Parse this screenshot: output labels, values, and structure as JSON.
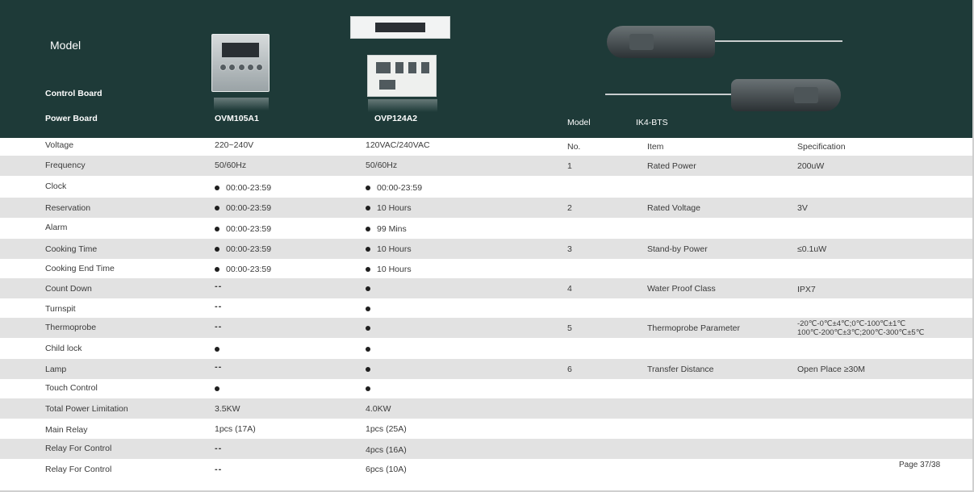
{
  "header": {
    "model_label": "Model",
    "control_board_label": "Control Board",
    "power_board_label": "Power Board",
    "model_a": "OVM105A1",
    "model_b": "OVP124A2",
    "probe_model_label": "Model",
    "probe_model_value": "IK4-BTS"
  },
  "board_table": {
    "rows": [
      {
        "label": "Voltage",
        "a": "220~240V",
        "b": "120VAC/240VAC"
      },
      {
        "label": "Frequency",
        "a": "50/60Hz",
        "b": "50/60Hz"
      },
      {
        "label": "Clock",
        "a": "00:00-23:59",
        "b": "00:00-23:59"
      },
      {
        "label": "Reservation",
        "a": "00:00-23:59",
        "b": "10 Hours"
      },
      {
        "label": "Alarm",
        "a": "00:00-23:59",
        "b": "99 Mins"
      },
      {
        "label": "Cooking Time",
        "a": "00:00-23:59",
        "b": "10 Hours"
      },
      {
        "label": "Cooking End Time",
        "a": "00:00-23:59",
        "b": "10 Hours"
      },
      {
        "label": "Count Down",
        "a": "--",
        "b": ""
      },
      {
        "label": "Turnspit",
        "a": "--",
        "b": ""
      },
      {
        "label": "Thermoprobe",
        "a": "--",
        "b": ""
      },
      {
        "label": "Child lock",
        "a": "",
        "b": ""
      },
      {
        "label": "Lamp",
        "a": "--",
        "b": ""
      },
      {
        "label": "Touch Control",
        "a": "",
        "b": ""
      },
      {
        "label": "Total Power Limitation",
        "a": "3.5KW",
        "b": "4.0KW"
      },
      {
        "label": "Main Relay",
        "a": "1pcs  (17A)",
        "b": "1pcs  (25A)"
      },
      {
        "label": "Relay For Control",
        "a": "--",
        "b": "4pcs  (16A)"
      },
      {
        "label": "Relay For Control",
        "a": "--",
        "b": "6pcs  (10A)"
      }
    ]
  },
  "probe_table": {
    "header": {
      "no": "No.",
      "item": "Item",
      "spec": "Specification"
    },
    "rows": [
      {
        "no": "1",
        "item": "Rated Power",
        "spec": "200uW"
      },
      {
        "no": "2",
        "item": "Rated Voltage",
        "spec": "3V"
      },
      {
        "no": "3",
        "item": "Stand-by Power",
        "spec": "≤0.1uW"
      },
      {
        "no": "4",
        "item": "Water Proof Class",
        "spec": "IPX7"
      },
      {
        "no": "5",
        "item": "Thermoprobe Parameter",
        "spec": "-20℃-0℃±4℃;0℃-100℃±1℃",
        "spec2": "100℃-200℃±3℃;200℃-300℃±5℃"
      },
      {
        "no": "6",
        "item": "Transfer Distance",
        "spec": "Open Place ≥30M"
      }
    ]
  },
  "footer": {
    "page": "Page 37/38"
  },
  "colors": {
    "header_bg": "#1e3a38",
    "stripe": "#e2e2e2",
    "text": "#3a3a3a"
  }
}
